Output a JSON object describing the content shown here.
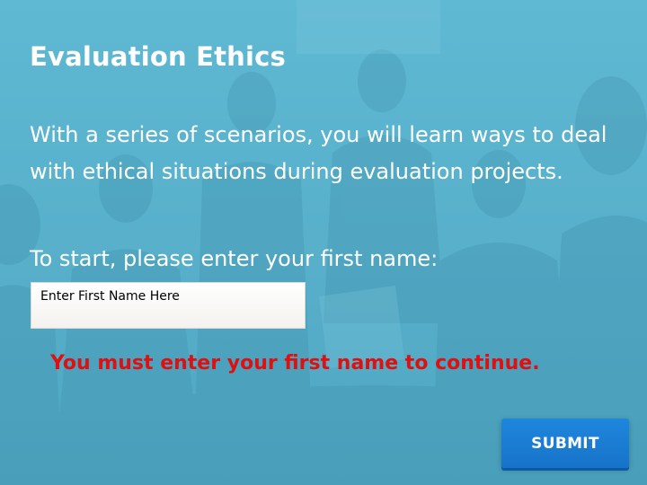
{
  "slide": {
    "title": "Evaluation Ethics",
    "intro": "With a series of scenarios, you will learn ways to deal with ethical situations during evaluation projects.",
    "prompt": "To start, please enter your first name:",
    "name_input": {
      "placeholder": "Enter First Name Here",
      "value": ""
    },
    "error_message": "You must enter your first name to continue.",
    "submit_label": "SUBMIT"
  },
  "colors": {
    "background": "#5ab4cf",
    "text": "#ffffff",
    "error": "#e01010",
    "button": "#1a7ad4"
  }
}
